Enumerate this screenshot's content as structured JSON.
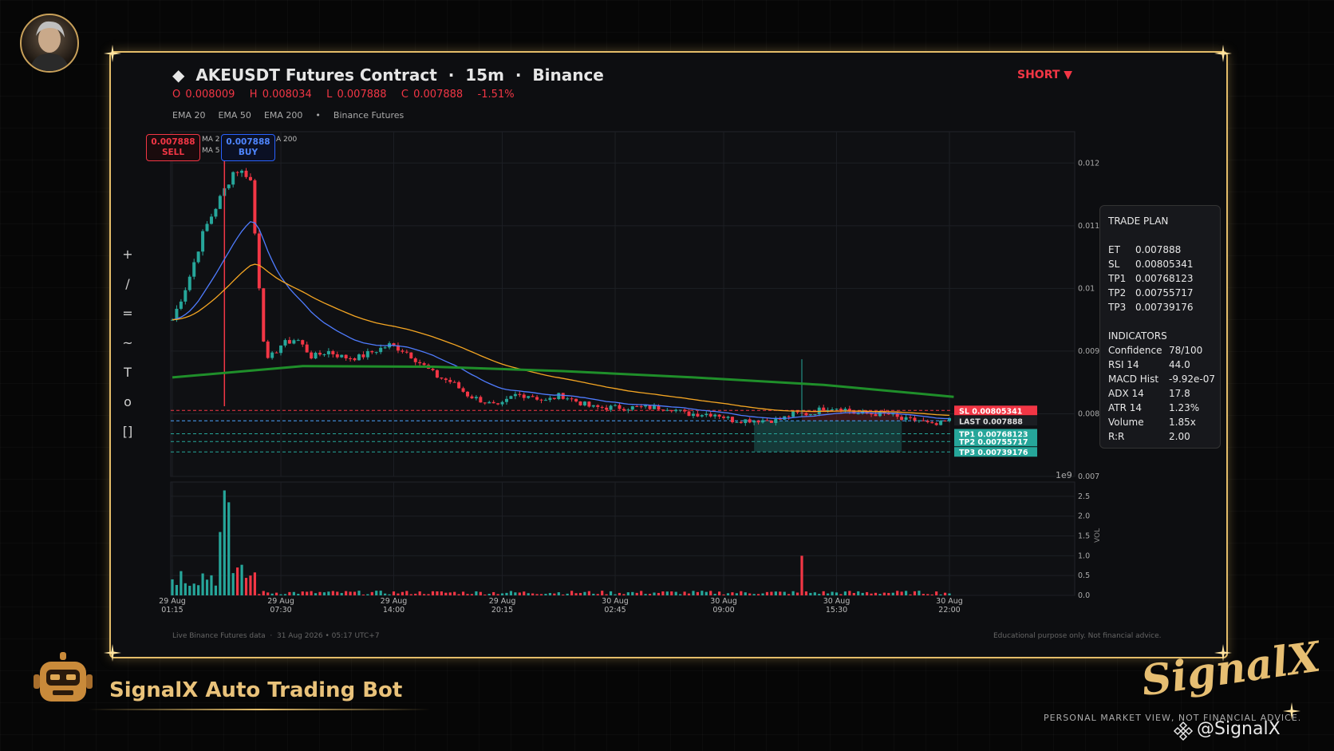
{
  "header": {
    "title_symbol": "◆",
    "title": "AKEUSDT Futures Contract  ·  15m  ·  Binance",
    "ohlc": "O 0.008009   H 0.008034   L 0.007888   C 0.007888   -1.51%",
    "ema_labels": [
      "EMA 20",
      "EMA 50",
      "EMA 200",
      "•",
      "Binance Futures"
    ],
    "direction": "SHORT ▼"
  },
  "toolbar": {
    "tools": [
      "+",
      "/",
      "=",
      "~",
      "T",
      "o",
      "[]"
    ]
  },
  "quote": {
    "sell_price": "0.007888",
    "sell_label": "SELL",
    "buy_price": "0.007888",
    "buy_label": "BUY",
    "ma_labels": [
      "MA 2",
      "MA 5",
      "A 200"
    ]
  },
  "trade_plan": {
    "heading": "TRADE PLAN",
    "levels": [
      {
        "k": "ET",
        "v": "0.007888"
      },
      {
        "k": "SL",
        "v": "0.00805341"
      },
      {
        "k": "TP1",
        "v": "0.00768123"
      },
      {
        "k": "TP2",
        "v": "0.00755717"
      },
      {
        "k": "TP3",
        "v": "0.00739176"
      }
    ],
    "indicators_heading": "INDICATORS",
    "indicators": [
      {
        "k": "Confidence",
        "v": "78/100"
      },
      {
        "k": "RSI 14",
        "v": "44.0"
      },
      {
        "k": "MACD Hist",
        "v": "-9.92e-07"
      },
      {
        "k": "ADX 14",
        "v": "17.8"
      },
      {
        "k": "ATR 14",
        "v": "1.23%"
      },
      {
        "k": "Volume",
        "v": "1.85x"
      },
      {
        "k": "R:R",
        "v": "2.00"
      }
    ]
  },
  "footer": {
    "left": "Live Binance Futures data  ·  31 Aug 2026 • 05:17 UTC+7",
    "right": "Educational purpose only. Not financial advice."
  },
  "branding": {
    "bot_title": "SignalX Auto Trading Bot",
    "logo": "SignalX",
    "tagline": "PERSONAL MARKET VIEW, NOT FINANCIAL ADVICE.",
    "handle": "@SignalX"
  },
  "colors": {
    "up": "#26a69a",
    "down": "#f23645",
    "ema20": "#4f7cff",
    "ema50": "#f5a623",
    "ema200": "#1f8f2a",
    "gold": "#e4bd6a"
  },
  "chart_data": {
    "type": "candlestick",
    "price_axis": {
      "ylim": [
        0.007,
        0.0125
      ],
      "ticks": [
        0.012,
        0.011,
        0.01,
        0.009,
        0.008,
        0.007
      ],
      "tick_labels": [
        "0.012",
        "0.011",
        "0.01",
        "0.009",
        "0.008",
        "0.007"
      ]
    },
    "x_axis_multiplier": "1e9",
    "time_ticks": [
      {
        "label": [
          "29 Aug",
          "01:15"
        ],
        "i": 0
      },
      {
        "label": [
          "29 Aug",
          "07:30"
        ],
        "i": 25
      },
      {
        "label": [
          "29 Aug",
          "14:00"
        ],
        "i": 51
      },
      {
        "label": [
          "29 Aug",
          "20:15"
        ],
        "i": 76
      },
      {
        "label": [
          "30 Aug",
          "02:45"
        ],
        "i": 102
      },
      {
        "label": [
          "30 Aug",
          "09:00"
        ],
        "i": 127
      },
      {
        "label": [
          "30 Aug",
          "15:30"
        ],
        "i": 153
      },
      {
        "label": [
          "30 Aug",
          "22:00"
        ],
        "i": 179
      }
    ],
    "volume_axis": {
      "ylim": [
        0,
        2.7
      ],
      "ticks": [
        0,
        0.5,
        1,
        1.5,
        2,
        2.5
      ],
      "tick_labels": [
        "0.0",
        "0.5",
        "1.0",
        "1.5",
        "2.0",
        "2.5"
      ],
      "label": "VOL"
    },
    "levels": {
      "sl": 0.00805341,
      "sl_label": "SL  0.00805341",
      "last": 0.007888,
      "last_label": "LAST  0.007888",
      "tp1": 0.00768123,
      "tp1_label": "TP1  0.00768123",
      "tp2": 0.00755717,
      "tp2_label": "TP2  0.00755717",
      "tp3": 0.00739176,
      "tp3_label": "TP3  0.00739176"
    },
    "ema200_endpoints": [
      [
        0,
        0.00858
      ],
      [
        30,
        0.00876
      ],
      [
        60,
        0.00875
      ],
      [
        90,
        0.00868
      ],
      [
        120,
        0.00858
      ],
      [
        150,
        0.00846
      ],
      [
        180,
        0.00827
      ]
    ],
    "closes_sampled": [
      0.0095,
      0.0101,
      0.0109,
      0.0114,
      0.0119,
      0.0118,
      0.0088,
      0.0091,
      0.0092,
      0.0089,
      0.009,
      0.0089,
      0.0089,
      0.009,
      0.0091,
      0.009,
      0.0088,
      0.0086,
      0.0085,
      0.0083,
      0.0082,
      0.0081,
      0.0083,
      0.0083,
      0.0082,
      0.0083,
      0.0082,
      0.0081,
      0.0081,
      0.0081,
      0.0081,
      0.0081,
      0.0081,
      0.008,
      0.008,
      0.008,
      0.0079,
      0.0079,
      0.0079,
      0.0079,
      0.008,
      0.008,
      0.0081,
      0.0081,
      0.008,
      0.008,
      0.008,
      0.0079,
      0.0079,
      0.0078,
      0.0079
    ],
    "volume_spikes": [
      {
        "i": 12,
        "v": 2.65
      },
      {
        "i": 13,
        "v": 2.35
      },
      {
        "i": 11,
        "v": 1.6
      },
      {
        "i": 145,
        "v": 1.0
      }
    ]
  }
}
